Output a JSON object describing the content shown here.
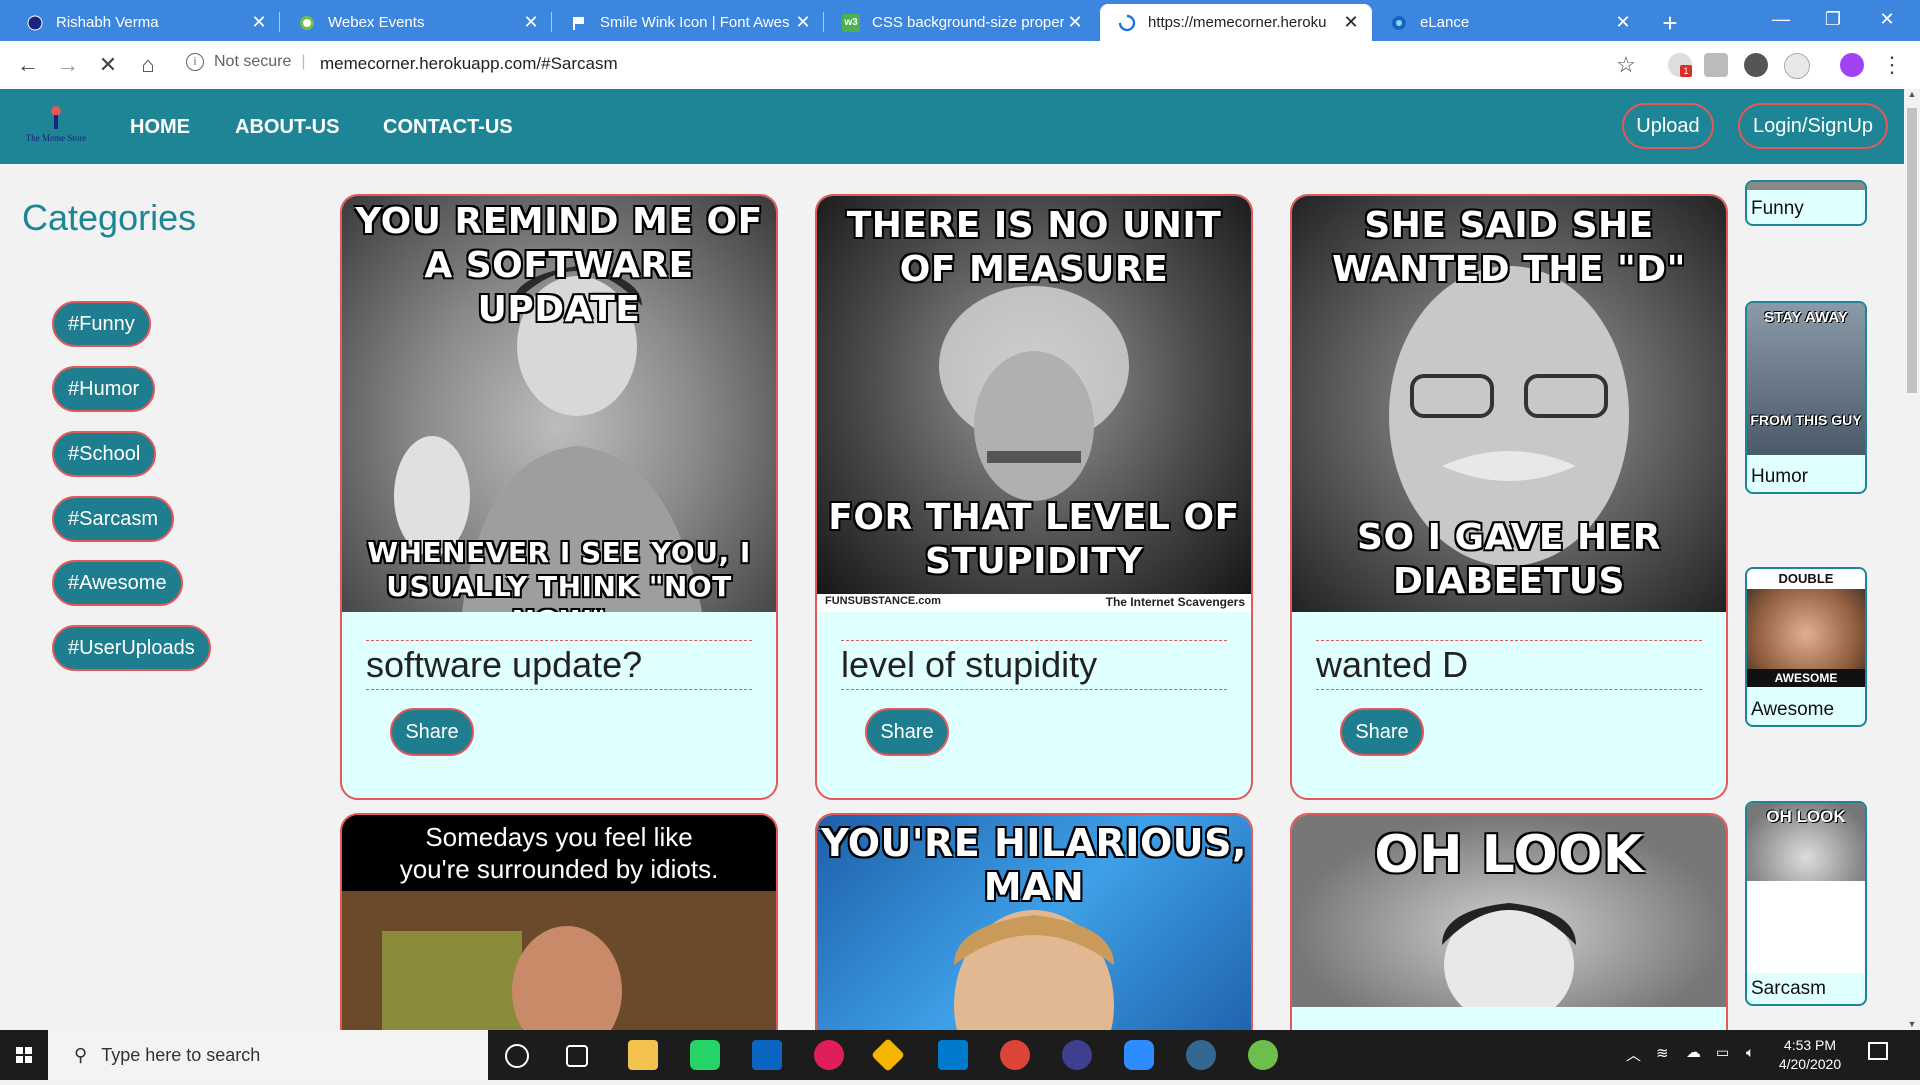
{
  "browser": {
    "tabs": [
      {
        "title": "Rishabh Verma",
        "icon": "globe-icon",
        "active": false
      },
      {
        "title": "Webex Events",
        "icon": "webex-icon",
        "active": false
      },
      {
        "title": "Smile Wink Icon | Font Awes",
        "icon": "flag-icon",
        "active": false
      },
      {
        "title": "CSS background-size proper",
        "icon": "w3-icon",
        "active": false
      },
      {
        "title": "https://memecorner.heroku",
        "icon": "loading-icon",
        "active": true
      },
      {
        "title": "eLance",
        "icon": "elance-icon",
        "active": false
      }
    ],
    "security_label": "Not secure",
    "url": "memecorner.herokuapp.com/#Sarcasm",
    "ext_badge": "1"
  },
  "site": {
    "logo_text": "The Meme Store",
    "nav": {
      "home": "HOME",
      "about": "ABOUT-US",
      "contact": "CONTACT-US"
    },
    "upload_label": "Upload",
    "login_label": "Login/SignUp"
  },
  "categories": {
    "title": "Categories",
    "tags": [
      "#Funny",
      "#Humor",
      "#School",
      "#Sarcasm",
      "#Awesome",
      "#UserUploads"
    ]
  },
  "memes": [
    {
      "top": "YOU REMIND ME OF A SOFTWARE UPDATE",
      "bottom": "WHENEVER I SEE YOU, I USUALLY THINK \"NOT NOW\"",
      "caption": "software update?",
      "share": "Share"
    },
    {
      "top": "THERE IS NO UNIT OF MEASURE",
      "bottom": "FOR THAT LEVEL OF STUPIDITY",
      "caption": "level of stupidity",
      "share": "Share",
      "watermark_left": "FUNSUBSTANCE.com",
      "watermark_right": "The Internet Scavengers"
    },
    {
      "top": "SHE SAID SHE WANTED THE \"D\"",
      "bottom": "SO I GAVE HER DIABEETUS",
      "caption": "wanted D",
      "share": "Share"
    }
  ],
  "memes_row2": [
    {
      "text_line1": "Somedays you feel like",
      "text_line2": "you're surrounded by idiots."
    },
    {
      "top": "YOU'RE HILARIOUS, MAN"
    },
    {
      "top": "OH LOOK"
    }
  ],
  "sidebar_thumbs": [
    {
      "label": "Funny",
      "img_top": "",
      "img_bottom": ""
    },
    {
      "label": "Humor",
      "img_top": "STAY AWAY",
      "img_bottom": "FROM THIS GUY"
    },
    {
      "label": "Awesome",
      "img_top": "DOUBLE",
      "img_bottom": "AWESOME"
    },
    {
      "label": "Sarcasm",
      "img_top": "OH LOOK",
      "img_bottom": ""
    }
  ],
  "taskbar": {
    "search_placeholder": "Type here to search",
    "time": "4:53 PM",
    "date": "4/20/2020"
  }
}
